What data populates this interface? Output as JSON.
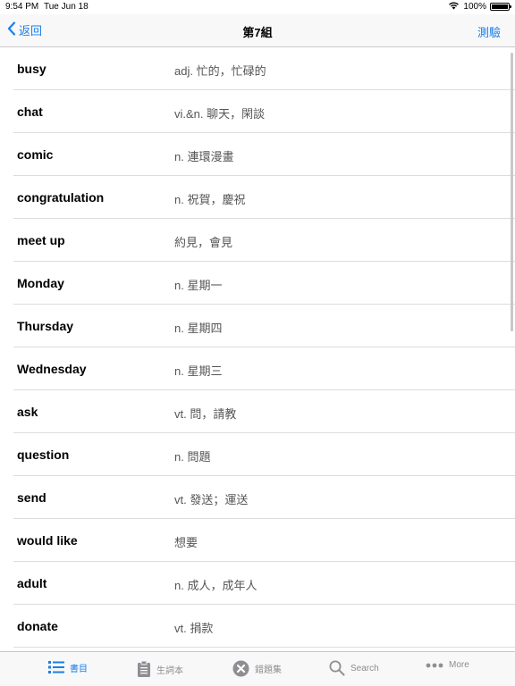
{
  "status_bar": {
    "time": "9:54 PM",
    "date": "Tue Jun 18",
    "battery": "100%",
    "battery_level": 1.0
  },
  "nav": {
    "back_label": "返回",
    "title": "第7組",
    "action_label": "測驗"
  },
  "words": [
    {
      "word": "busy",
      "definition": "adj. 忙的，忙碌的"
    },
    {
      "word": "chat",
      "definition": "vi.&n. 聊天，閑談"
    },
    {
      "word": "comic",
      "definition": "n. 連環漫畫"
    },
    {
      "word": "congratulation",
      "definition": "n. 祝賀，慶祝"
    },
    {
      "word": "meet up",
      "definition": "約見，會見"
    },
    {
      "word": "Monday",
      "definition": "n. 星期一"
    },
    {
      "word": "Thursday",
      "definition": "n. 星期四"
    },
    {
      "word": "Wednesday",
      "definition": "n. 星期三"
    },
    {
      "word": "ask",
      "definition": "vt. 問，請教"
    },
    {
      "word": "question",
      "definition": "n. 問題"
    },
    {
      "word": "send",
      "definition": "vt. 發送；運送"
    },
    {
      "word": "would like",
      "definition": "想要"
    },
    {
      "word": "adult",
      "definition": "n. 成人，成年人"
    },
    {
      "word": "donate",
      "definition": "vt. 捐款"
    }
  ],
  "tabs": [
    {
      "label": "書目",
      "icon": "list-icon",
      "active": true
    },
    {
      "label": "生詞本",
      "icon": "clipboard-icon",
      "active": false
    },
    {
      "label": "錯題集",
      "icon": "x-circle-icon",
      "active": false
    },
    {
      "label": "Search",
      "icon": "search-icon",
      "active": false
    },
    {
      "label": "More",
      "icon": "more-icon",
      "active": false
    }
  ],
  "colors": {
    "accent": "#1a7fe9",
    "inactive": "#8e8e93"
  }
}
